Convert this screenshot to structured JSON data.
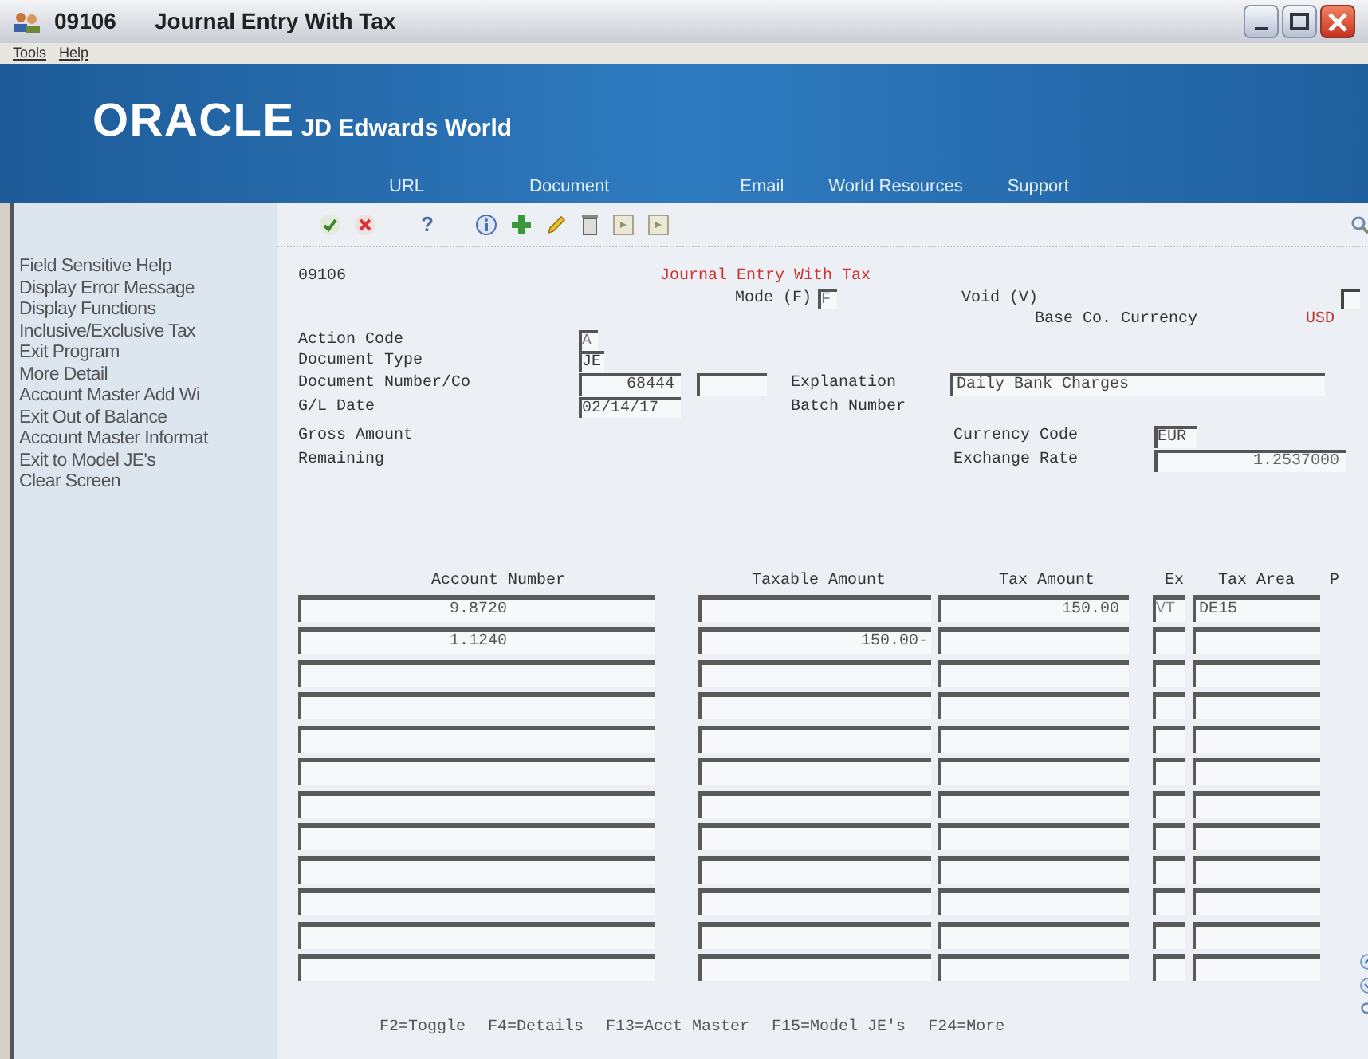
{
  "window": {
    "code": "09106",
    "title": "Journal Entry With Tax"
  },
  "menu": [
    "Tools",
    "Help"
  ],
  "toolbar": {
    "help": "?"
  },
  "banner": {
    "brand": "ORACLE",
    "product": "JD Edwards World",
    "links": [
      "URL",
      "Document",
      "Email",
      "World Resources",
      "Support"
    ]
  },
  "sidebar": {
    "items": [
      "Field Sensitive Help",
      "Display Error Message",
      "Display Functions",
      "Inclusive/Exclusive Tax",
      "Exit Program",
      "More Detail",
      "Account Master Add Wi",
      "Exit Out of Balance",
      "Account Master Informat",
      "Exit to Model JE's",
      "Clear Screen"
    ]
  },
  "form": {
    "program_code": "09106",
    "heading": "Journal Entry With Tax",
    "mode": {
      "label": "Mode (F)",
      "value": "F"
    },
    "void": {
      "label": "Void (V)",
      "checked": false
    },
    "base_currency": {
      "label": "Base Co. Currency",
      "value": "USD"
    },
    "action_code": {
      "label": "Action Code",
      "value": "A"
    },
    "document_type": {
      "label": "Document Type",
      "value": "JE"
    },
    "document_number": {
      "label": "Document Number/Co",
      "value": "68444"
    },
    "explanation": {
      "label": "Explanation",
      "value": "Daily Bank Charges"
    },
    "gl_date": {
      "label": "G/L Date",
      "value": "02/14/17"
    },
    "batch_number": {
      "label": "Batch Number"
    },
    "gross_amount": {
      "label": "Gross Amount"
    },
    "currency_code": {
      "label": "Currency Code",
      "value": "EUR"
    },
    "remaining": {
      "label": "Remaining"
    },
    "exchange_rate": {
      "label": "Exchange Rate",
      "value": "1.2537000"
    }
  },
  "grid": {
    "columns": [
      "Account Number",
      "Taxable Amount",
      "Tax Amount",
      "Ex",
      "Tax Area",
      "P"
    ],
    "rows": [
      {
        "account": "9.8720",
        "tax_amount": "150.00",
        "ex": "VT",
        "tax_area": "DE15"
      },
      {
        "account": "1.1240",
        "taxable": "150.00-"
      },
      {},
      {},
      {},
      {},
      {},
      {},
      {},
      {},
      {},
      {}
    ]
  },
  "function_keys": [
    "F2=Toggle",
    "F4=Details",
    "F13=Acct Master",
    "F15=Model JE's",
    "F24=More"
  ]
}
